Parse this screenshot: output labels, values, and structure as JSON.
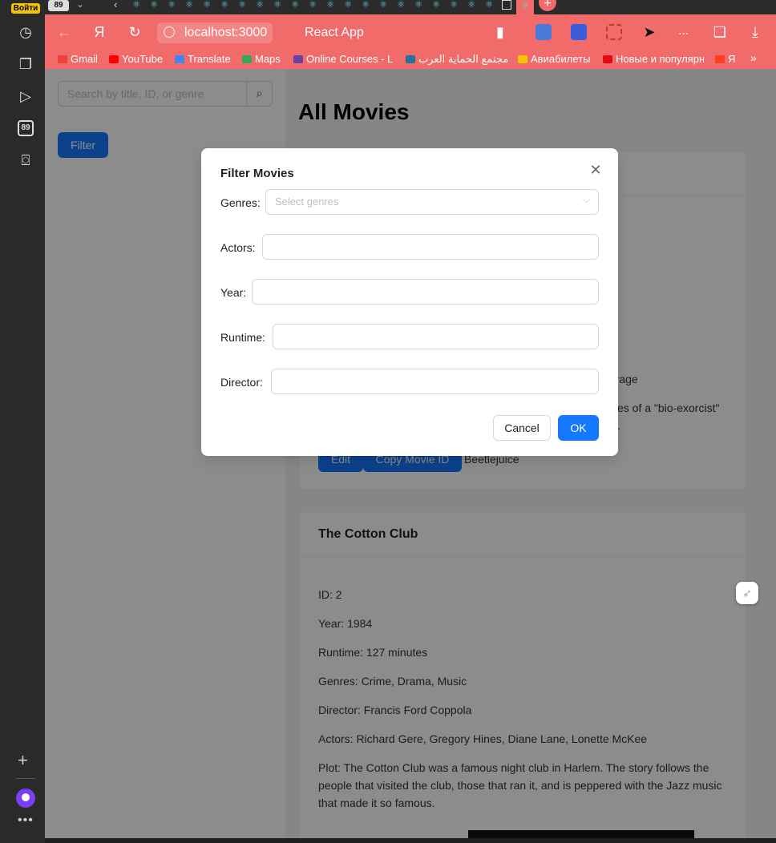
{
  "topstrip": {
    "login_label": "Войти",
    "tab_count": "89"
  },
  "sidebar": {
    "badge_count": "89"
  },
  "browser": {
    "url": "localhost:3000",
    "page_title": "React App",
    "more": "...",
    "bookmarks": [
      "Gmail",
      "YouTube",
      "Translate",
      "Maps",
      "Online Courses - L",
      "مجتمع الحماية العرب",
      "Авиабилеты",
      "Новые и популярн",
      "Я"
    ],
    "bookmark_colors": [
      "#ea4335",
      "#ff0000",
      "#4285f4",
      "#34a853",
      "#6b3fa0",
      "#21759b",
      "#f5c400",
      "#e50914",
      "#fc3f1d"
    ]
  },
  "page": {
    "search": {
      "placeholder": "Search by title, ID, or genre"
    },
    "filter_label": "Filter",
    "heading": "All Movies",
    "card1": {
      "director_fragment": "Page",
      "plot_fragment": "ces of a \"bio-exorcist\"",
      "plot_fragment2": "s.",
      "edit_label": "Edit",
      "copy_label": "Copy Movie ID",
      "image_alt": "Beetlejuice"
    },
    "card2": {
      "title": "The Cotton Club",
      "id": "ID: 2",
      "year": "Year: 1984",
      "runtime": "Runtime: 127 minutes",
      "genres": "Genres: Crime, Drama, Music",
      "director": "Director: Francis Ford Coppola",
      "actors": "Actors: Richard Gere, Gregory Hines, Diane Lane, Lonette McKee",
      "plot_line1": "Plot: The Cotton Club was a famous night club in Harlem. The story follows the",
      "plot_line2": "people that visited the club, those that ran it, and is peppered with the Jazz music",
      "plot_line3": "that made it so famous."
    }
  },
  "modal": {
    "title": "Filter Movies",
    "genres_label": "Genres:",
    "genres_placeholder": "Select genres",
    "actors_label": "Actors:",
    "actors_value": "",
    "year_label": "Year:",
    "year_value": "",
    "runtime_label": "Runtime:",
    "runtime_value": "",
    "director_label": "Director:",
    "director_value": "",
    "cancel_label": "Cancel",
    "ok_label": "OK"
  },
  "colors": {
    "browser_accent": "#f26b6b",
    "primary": "#1677ff"
  }
}
